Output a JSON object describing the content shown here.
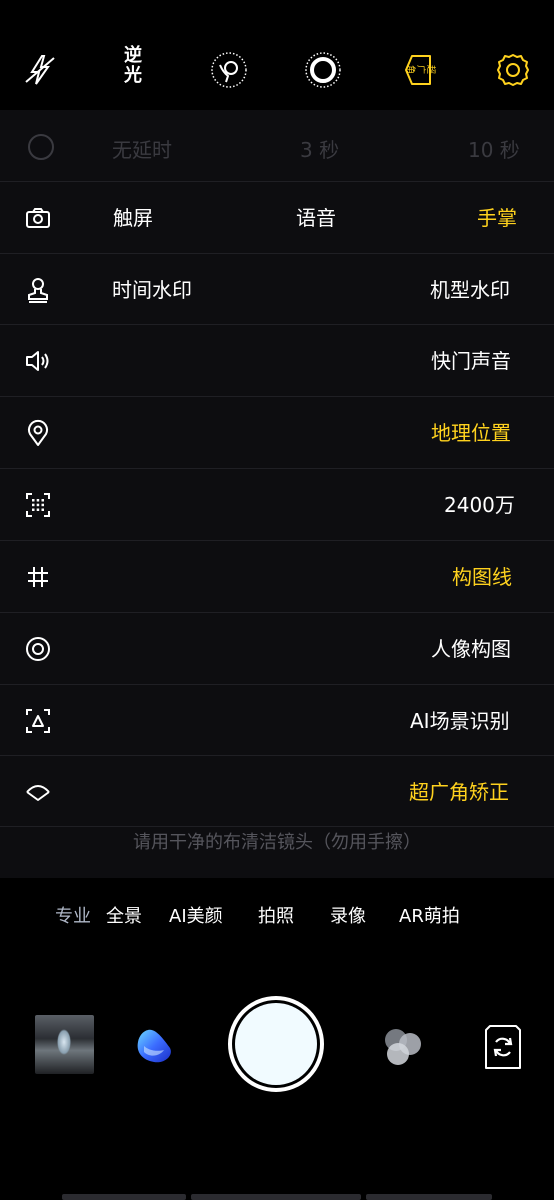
{
  "top_bar": {
    "flash_icon": "flash-off-icon",
    "backlight_label": "逆光",
    "filter_icon": "filter-icon",
    "live_photo_icon": "live-photo-icon",
    "ultra_wide_label": "超广角",
    "settings_icon": "gear-icon",
    "accent_color": "#ffd21e"
  },
  "settings_panel": {
    "faded_row": {
      "label": "无延时",
      "opt1": "3 秒",
      "opt2": "10 秒"
    },
    "rows": [
      {
        "icon": "camera-icon",
        "options": [
          "触屏",
          "语音",
          "手掌"
        ],
        "active": "手掌"
      },
      {
        "icon": "stamp-icon",
        "left_label": "时间水印",
        "right_label": "机型水印"
      },
      {
        "icon": "speaker-icon",
        "label": "快门声音",
        "active": false
      },
      {
        "icon": "location-icon",
        "label": "地理位置",
        "active": true
      },
      {
        "icon": "resolution-icon",
        "label": "2400万",
        "active": false
      },
      {
        "icon": "grid-icon",
        "label": "构图线",
        "active": true
      },
      {
        "icon": "portrait-composition-icon",
        "label": "人像构图",
        "active": false
      },
      {
        "icon": "ai-scene-icon",
        "label": "AI场景识别",
        "active": false
      },
      {
        "icon": "ultra-wide-correction-icon",
        "label": "超广角矫正",
        "active": true
      }
    ],
    "hint": "请用干净的布清洁镜头（勿用手擦）"
  },
  "modes": {
    "items": [
      "专业",
      "全景",
      "AI美颜",
      "拍照",
      "录像",
      "AR萌拍"
    ],
    "active": "拍照"
  },
  "bottom_bar": {
    "gallery_icon": "gallery-thumbnail",
    "beauty_icon": "beauty-blob-icon",
    "shutter": "shutter-button",
    "effects_icon": "effects-circles-icon",
    "switch_icon": "switch-camera-icon"
  }
}
